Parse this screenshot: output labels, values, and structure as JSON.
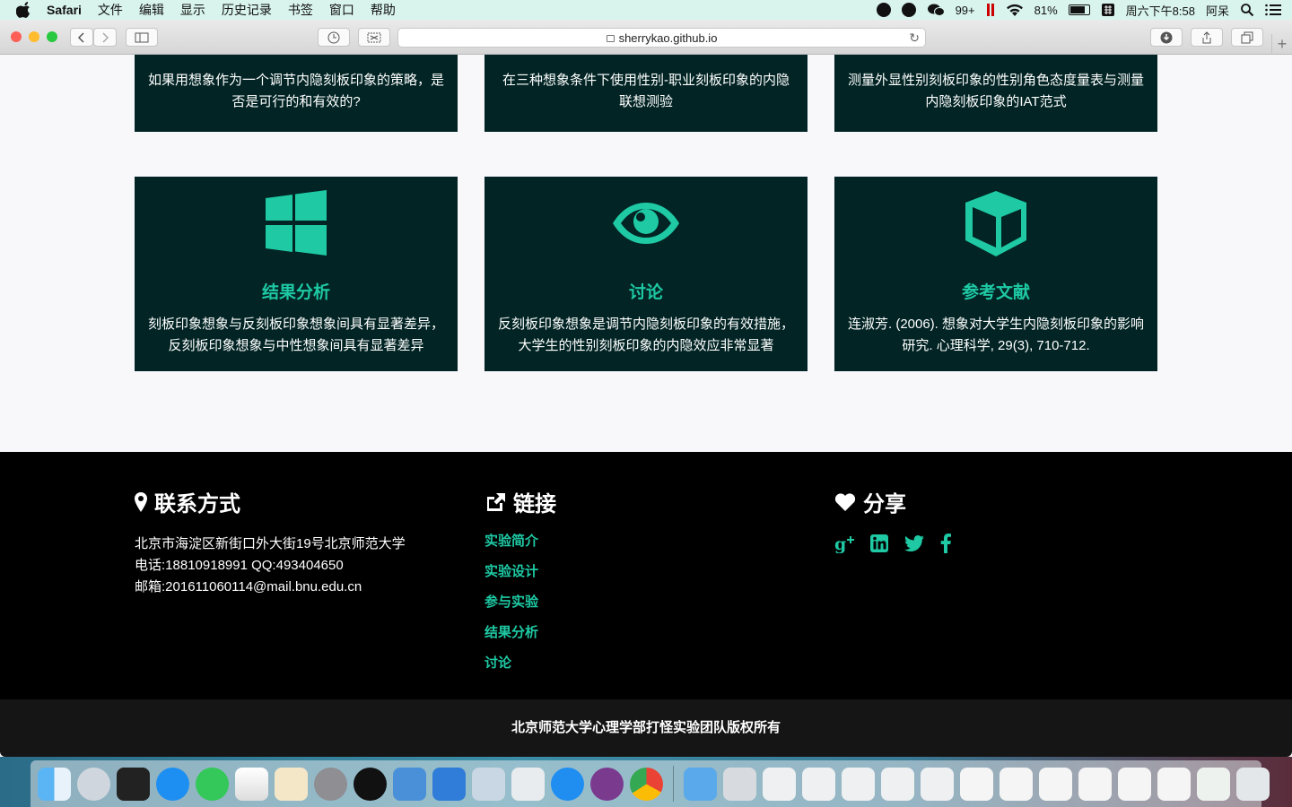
{
  "menubar": {
    "app_name": "Safari",
    "items": [
      "文件",
      "编辑",
      "显示",
      "历史记录",
      "书签",
      "窗口",
      "帮助"
    ],
    "notification_count": "99+",
    "battery": "81%",
    "clock": "周六下午8:58",
    "user": "阿呆"
  },
  "browser": {
    "url": "sherrykao.github.io"
  },
  "top_cards": [
    {
      "desc": "如果用想象作为一个调节内隐刻板印象的策略，是否是可行的和有效的?"
    },
    {
      "desc": "在三种想象条件下使用性别-职业刻板印象的内隐联想测验"
    },
    {
      "desc": "测量外显性别刻板印象的性别角色态度量表与测量内隐刻板印象的IAT范式"
    }
  ],
  "cards": [
    {
      "icon": "windows-icon",
      "title": "结果分析",
      "desc": "刻板印象想象与反刻板印象想象间具有显著差异，反刻板印象想象与中性想象间具有显著差异"
    },
    {
      "icon": "eye-icon",
      "title": "讨论",
      "desc": "反刻板印象想象是调节内隐刻板印象的有效措施，大学生的性别刻板印象的内隐效应非常显著"
    },
    {
      "icon": "cube-icon",
      "title": "参考文献",
      "desc": "连淑芳. (2006). 想象对大学生内隐刻板印象的影响研究. 心理科学, 29(3), 710-712."
    }
  ],
  "footer": {
    "contact": {
      "heading": "联系方式",
      "address": "北京市海淀区新街口外大街19号北京师范大学",
      "phone": "电话:18810918991 QQ:493404650",
      "email": "邮箱:201611060114@mail.bnu.edu.cn"
    },
    "links": {
      "heading": "链接",
      "items": [
        "实验简介",
        "实验设计",
        "参与实验",
        "结果分析",
        "讨论"
      ]
    },
    "share": {
      "heading": "分享",
      "icons": [
        "google-plus-icon",
        "linkedin-icon",
        "twitter-icon",
        "facebook-icon"
      ]
    },
    "copyright": "北京师范大学心理学部打怪实验团队版权所有"
  },
  "colors": {
    "accent": "#1ec9a4",
    "card_bg": "#022424",
    "footer_bg": "#000000"
  }
}
